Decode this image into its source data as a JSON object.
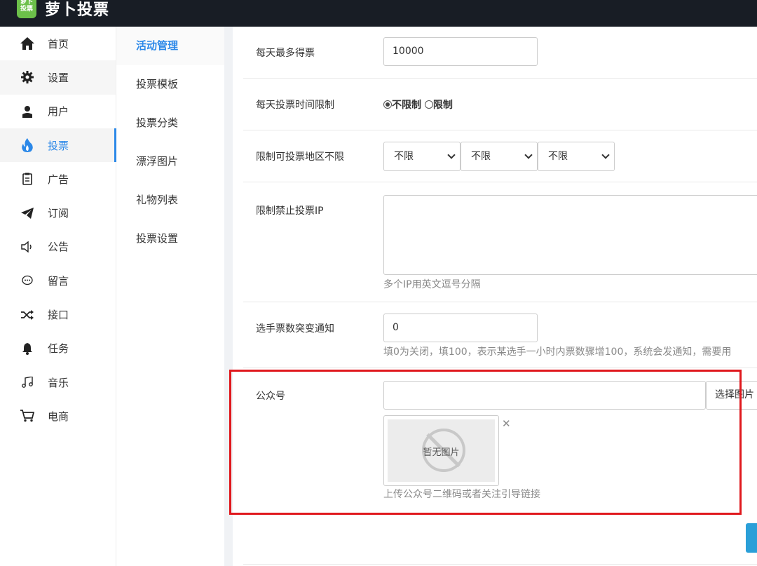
{
  "app": {
    "logo_text": "萝卜\n投票",
    "title": "萝卜投票"
  },
  "sidebar": {
    "items": [
      {
        "label": "首页",
        "icon": "home-icon"
      },
      {
        "label": "设置",
        "icon": "gear-icon"
      },
      {
        "label": "用户",
        "icon": "user-icon"
      },
      {
        "label": "投票",
        "icon": "fire-icon"
      },
      {
        "label": "广告",
        "icon": "clipboard-icon"
      },
      {
        "label": "订阅",
        "icon": "paper-plane-icon"
      },
      {
        "label": "公告",
        "icon": "speaker-icon"
      },
      {
        "label": "留言",
        "icon": "chat-icon"
      },
      {
        "label": "接口",
        "icon": "shuffle-icon"
      },
      {
        "label": "任务",
        "icon": "bell-icon"
      },
      {
        "label": "音乐",
        "icon": "music-icon"
      },
      {
        "label": "电商",
        "icon": "cart-icon"
      }
    ],
    "active_index": 3
  },
  "subnav": {
    "items": [
      "活动管理",
      "投票模板",
      "投票分类",
      "漂浮图片",
      "礼物列表",
      "投票设置"
    ],
    "active_index": 0
  },
  "form": {
    "max_votes_per_day": {
      "label": "每天最多得票",
      "value": "10000"
    },
    "time_limit": {
      "label": "每天投票时间限制",
      "option_unlimited": "不限制",
      "option_limited": "限制",
      "selected": "不限制"
    },
    "region": {
      "label": "限制可投票地区不限",
      "selects": [
        "不限",
        "不限",
        "不限"
      ]
    },
    "banned_ip": {
      "label": "限制禁止投票IP",
      "value": "",
      "help": "多个IP用英文逗号分隔"
    },
    "surge_notice": {
      "label": "选手票数突变通知",
      "value": "0",
      "help": "填0为关闭，填100，表示某选手一小时内票数骤增100，系统会发通知，需要用"
    },
    "official_account": {
      "label": "公众号",
      "value": "",
      "button": "选择图片",
      "no_image": "暂无图片",
      "help": "上传公众号二维码或者关注引导链接"
    }
  },
  "colors": {
    "accent": "#2b88e8",
    "highlight_box": "#e0181d",
    "topbar": "#181d25"
  }
}
